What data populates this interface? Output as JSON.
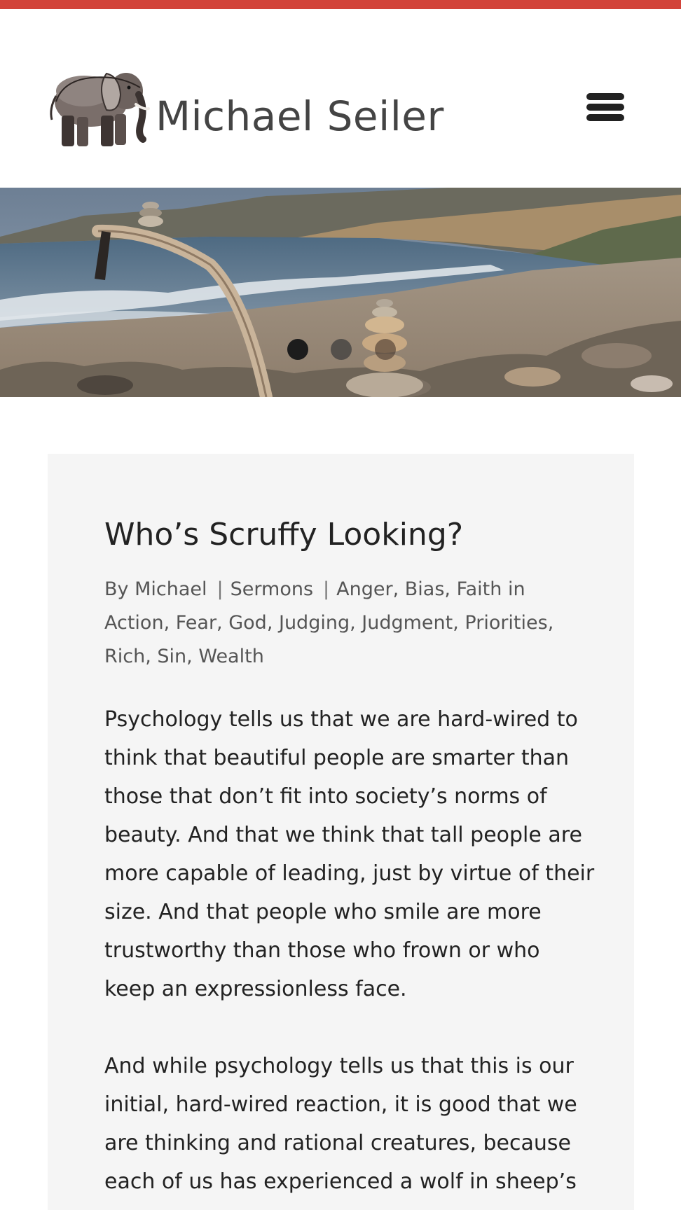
{
  "header": {
    "site_title": "Michael Seiler",
    "accent_color": "#d2443a",
    "menu_icon": "hamburger-menu-icon"
  },
  "hero": {
    "slides": 3,
    "active_slide": 1
  },
  "article": {
    "title": "Who’s Scruffy Looking?",
    "byline_prefix": "By",
    "author": "Michael",
    "category": "Sermons",
    "tags": [
      "Anger",
      "Bias",
      "Faith in Action",
      "Fear",
      "God",
      "Judging",
      "Judgment",
      "Priorities",
      "Rich",
      "Sin",
      "Wealth"
    ],
    "paragraphs": [
      "Psychology tells us that we are hard-wired to think that beautiful people are smarter than those that don’t fit into society’s norms of beauty. And that we think that tall people are more capable of leading, just by virtue of their size. And that people who smile are more trustworthy than those who frown or who keep an expressionless face.",
      "And while psychology tells us that this is our initial, hard-wired reaction, it is good that we are thinking and rational creatures, because each of us has experienced a wolf in sheep’s"
    ]
  }
}
